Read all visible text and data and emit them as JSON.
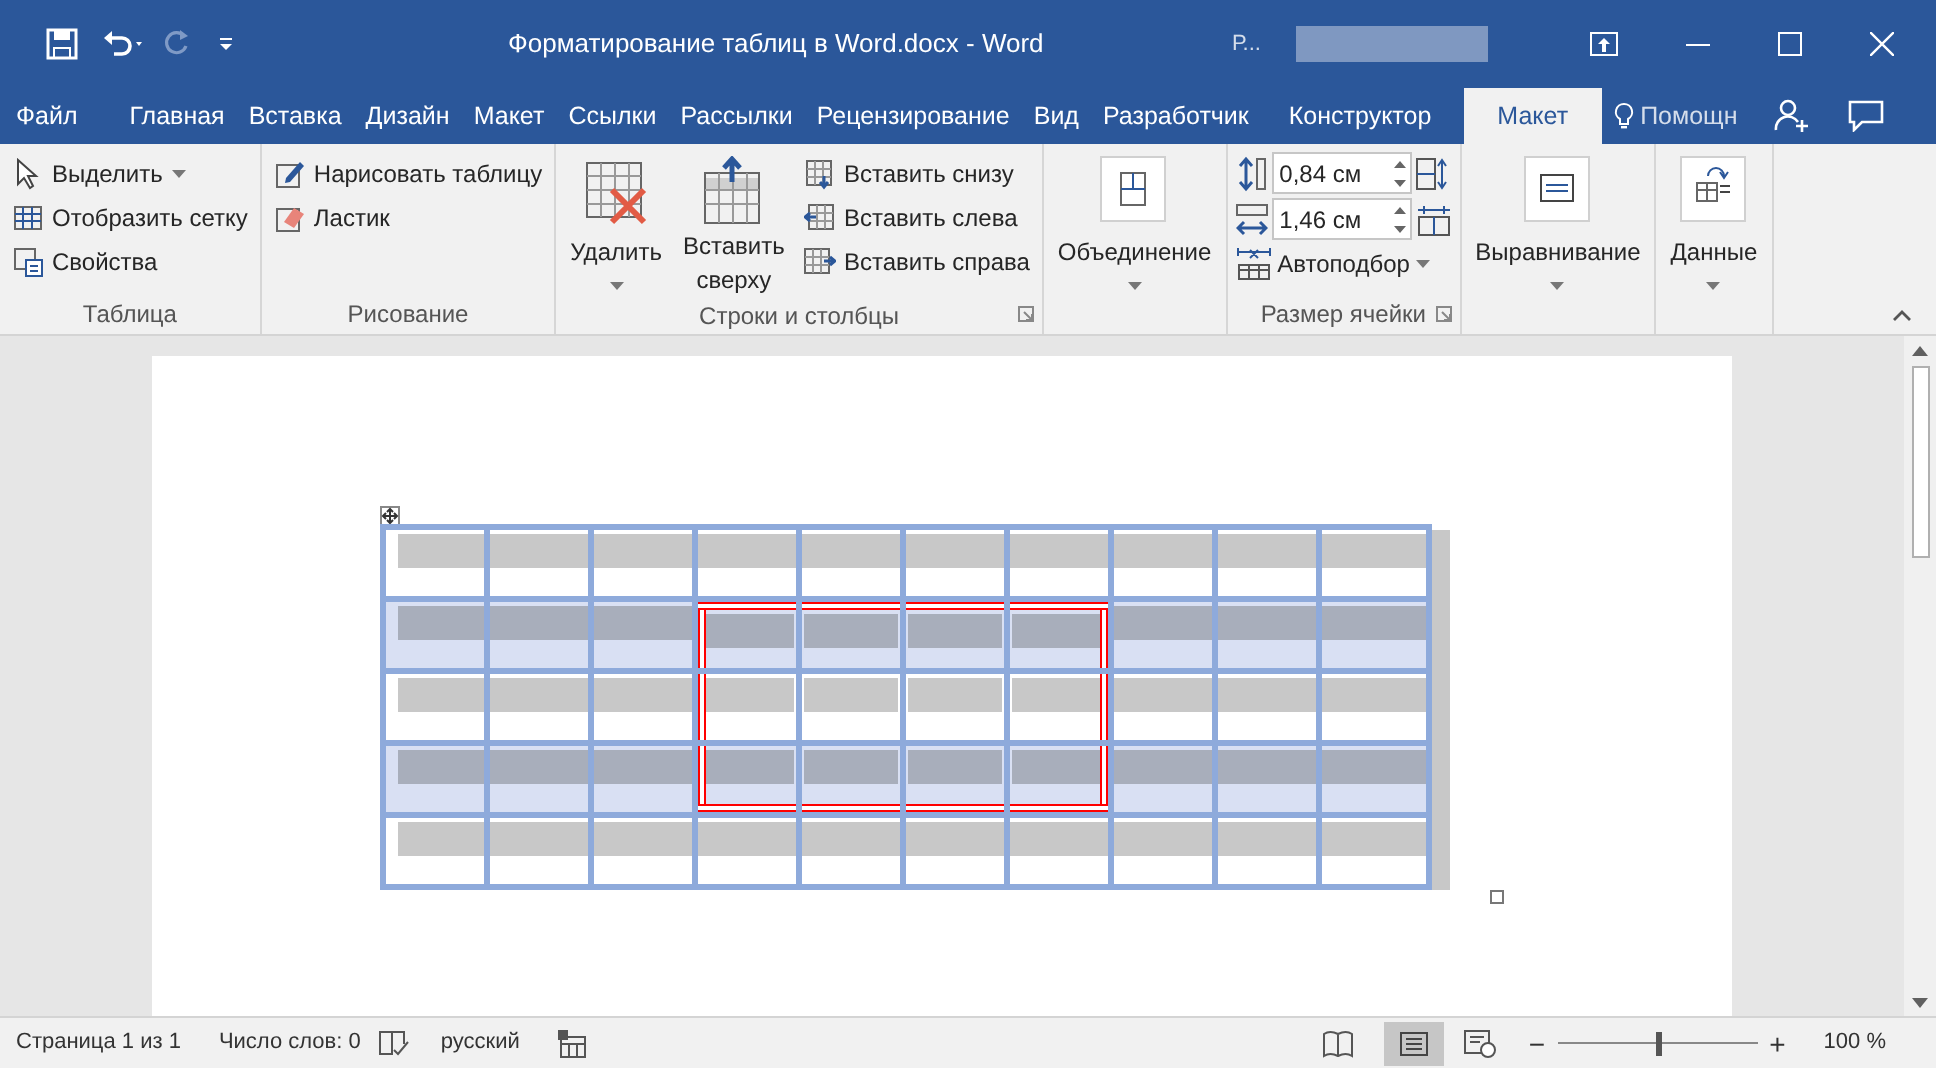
{
  "window": {
    "title": "Форматирование таблиц в Word.docx - Word",
    "account": "Р..."
  },
  "tabs": [
    {
      "label": "Файл",
      "selected": false
    },
    {
      "label": "Главная",
      "selected": false
    },
    {
      "label": "Вставка",
      "selected": false
    },
    {
      "label": "Дизайн",
      "selected": false
    },
    {
      "label": "Макет",
      "selected": false
    },
    {
      "label": "Ссылки",
      "selected": false
    },
    {
      "label": "Рассылки",
      "selected": false
    },
    {
      "label": "Рецензирование",
      "selected": false
    },
    {
      "label": "Вид",
      "selected": false
    },
    {
      "label": "Разработчик",
      "selected": false
    },
    {
      "label": "Конструктор",
      "selected": false
    },
    {
      "label": "Макет",
      "selected": true
    }
  ],
  "tell_me": "Помощн",
  "ribbon": {
    "groups": [
      {
        "label": "Таблица",
        "launcher": false,
        "items": [
          {
            "kind": "small",
            "label": "Выделить",
            "dropdown": true
          },
          {
            "kind": "small",
            "label": "Отобразить сетку",
            "dropdown": false
          },
          {
            "kind": "small",
            "label": "Свойства",
            "dropdown": false
          }
        ]
      },
      {
        "label": "Рисование",
        "launcher": false,
        "items": [
          {
            "kind": "small",
            "label": "Нарисовать таблицу",
            "dropdown": false
          },
          {
            "kind": "small",
            "label": "Ластик",
            "dropdown": false
          }
        ]
      },
      {
        "label": "Строки и столбцы",
        "launcher": true,
        "items": [
          {
            "kind": "large",
            "label": "Удалить",
            "dropdown": true
          },
          {
            "kind": "large",
            "label": "Вставить сверху",
            "dropdown": false
          },
          {
            "kind": "stack",
            "items": [
              {
                "kind": "small",
                "label": "Вставить снизу",
                "dropdown": false
              },
              {
                "kind": "small",
                "label": "Вставить слева",
                "dropdown": false
              },
              {
                "kind": "small",
                "label": "Вставить справа",
                "dropdown": false
              }
            ]
          }
        ]
      },
      {
        "launcher": false,
        "items": [
          {
            "kind": "large",
            "label": "Объединение",
            "dropdown": true
          }
        ]
      },
      {
        "label": "Размер ячейки",
        "launcher": true,
        "items": [
          {
            "kind": "size",
            "height": "0,84 см",
            "width": "1,46 см",
            "autofit": "Автоподбор"
          }
        ]
      },
      {
        "launcher": false,
        "items": [
          {
            "kind": "large",
            "label": "Выравнивание",
            "dropdown": true
          }
        ]
      },
      {
        "launcher": false,
        "items": [
          {
            "kind": "large",
            "label": "Данные",
            "dropdown": true
          }
        ]
      }
    ]
  },
  "table": {
    "rows": [
      {
        "selected": false,
        "cells": [
          {
            "framed": false
          },
          {
            "framed": false
          },
          {
            "framed": false
          },
          {
            "framed": false
          },
          {
            "framed": false
          },
          {
            "framed": false
          },
          {
            "framed": false
          },
          {
            "framed": false
          },
          {
            "framed": false
          },
          {
            "framed": false
          }
        ]
      },
      {
        "selected": true,
        "cells": [
          {
            "framed": false
          },
          {
            "framed": false
          },
          {
            "framed": false
          },
          {
            "framed": true
          },
          {
            "framed": true
          },
          {
            "framed": true
          },
          {
            "framed": true
          },
          {
            "framed": false
          },
          {
            "framed": false
          },
          {
            "framed": false
          }
        ]
      },
      {
        "selected": false,
        "cells": [
          {
            "framed": false
          },
          {
            "framed": false
          },
          {
            "framed": false
          },
          {
            "framed": true
          },
          {
            "framed": true
          },
          {
            "framed": true
          },
          {
            "framed": true
          },
          {
            "framed": false
          },
          {
            "framed": false
          },
          {
            "framed": false
          }
        ]
      },
      {
        "selected": true,
        "cells": [
          {
            "framed": false
          },
          {
            "framed": false
          },
          {
            "framed": false
          },
          {
            "framed": true
          },
          {
            "framed": true
          },
          {
            "framed": true
          },
          {
            "framed": true
          },
          {
            "framed": false
          },
          {
            "framed": false
          },
          {
            "framed": false
          }
        ]
      },
      {
        "selected": false,
        "cells": [
          {
            "framed": false
          },
          {
            "framed": false
          },
          {
            "framed": false
          },
          {
            "framed": false
          },
          {
            "framed": false
          },
          {
            "framed": false
          },
          {
            "framed": false
          },
          {
            "framed": false
          },
          {
            "framed": false
          },
          {
            "framed": false
          }
        ]
      }
    ]
  },
  "status_bar": {
    "page": "Страница 1 из 1",
    "words": "Число слов: 0",
    "language": "русский",
    "zoom": "100 %",
    "zoom_out": "−",
    "zoom_in": "+",
    "zoom_slider": {
      "level": 0.5
    }
  }
}
